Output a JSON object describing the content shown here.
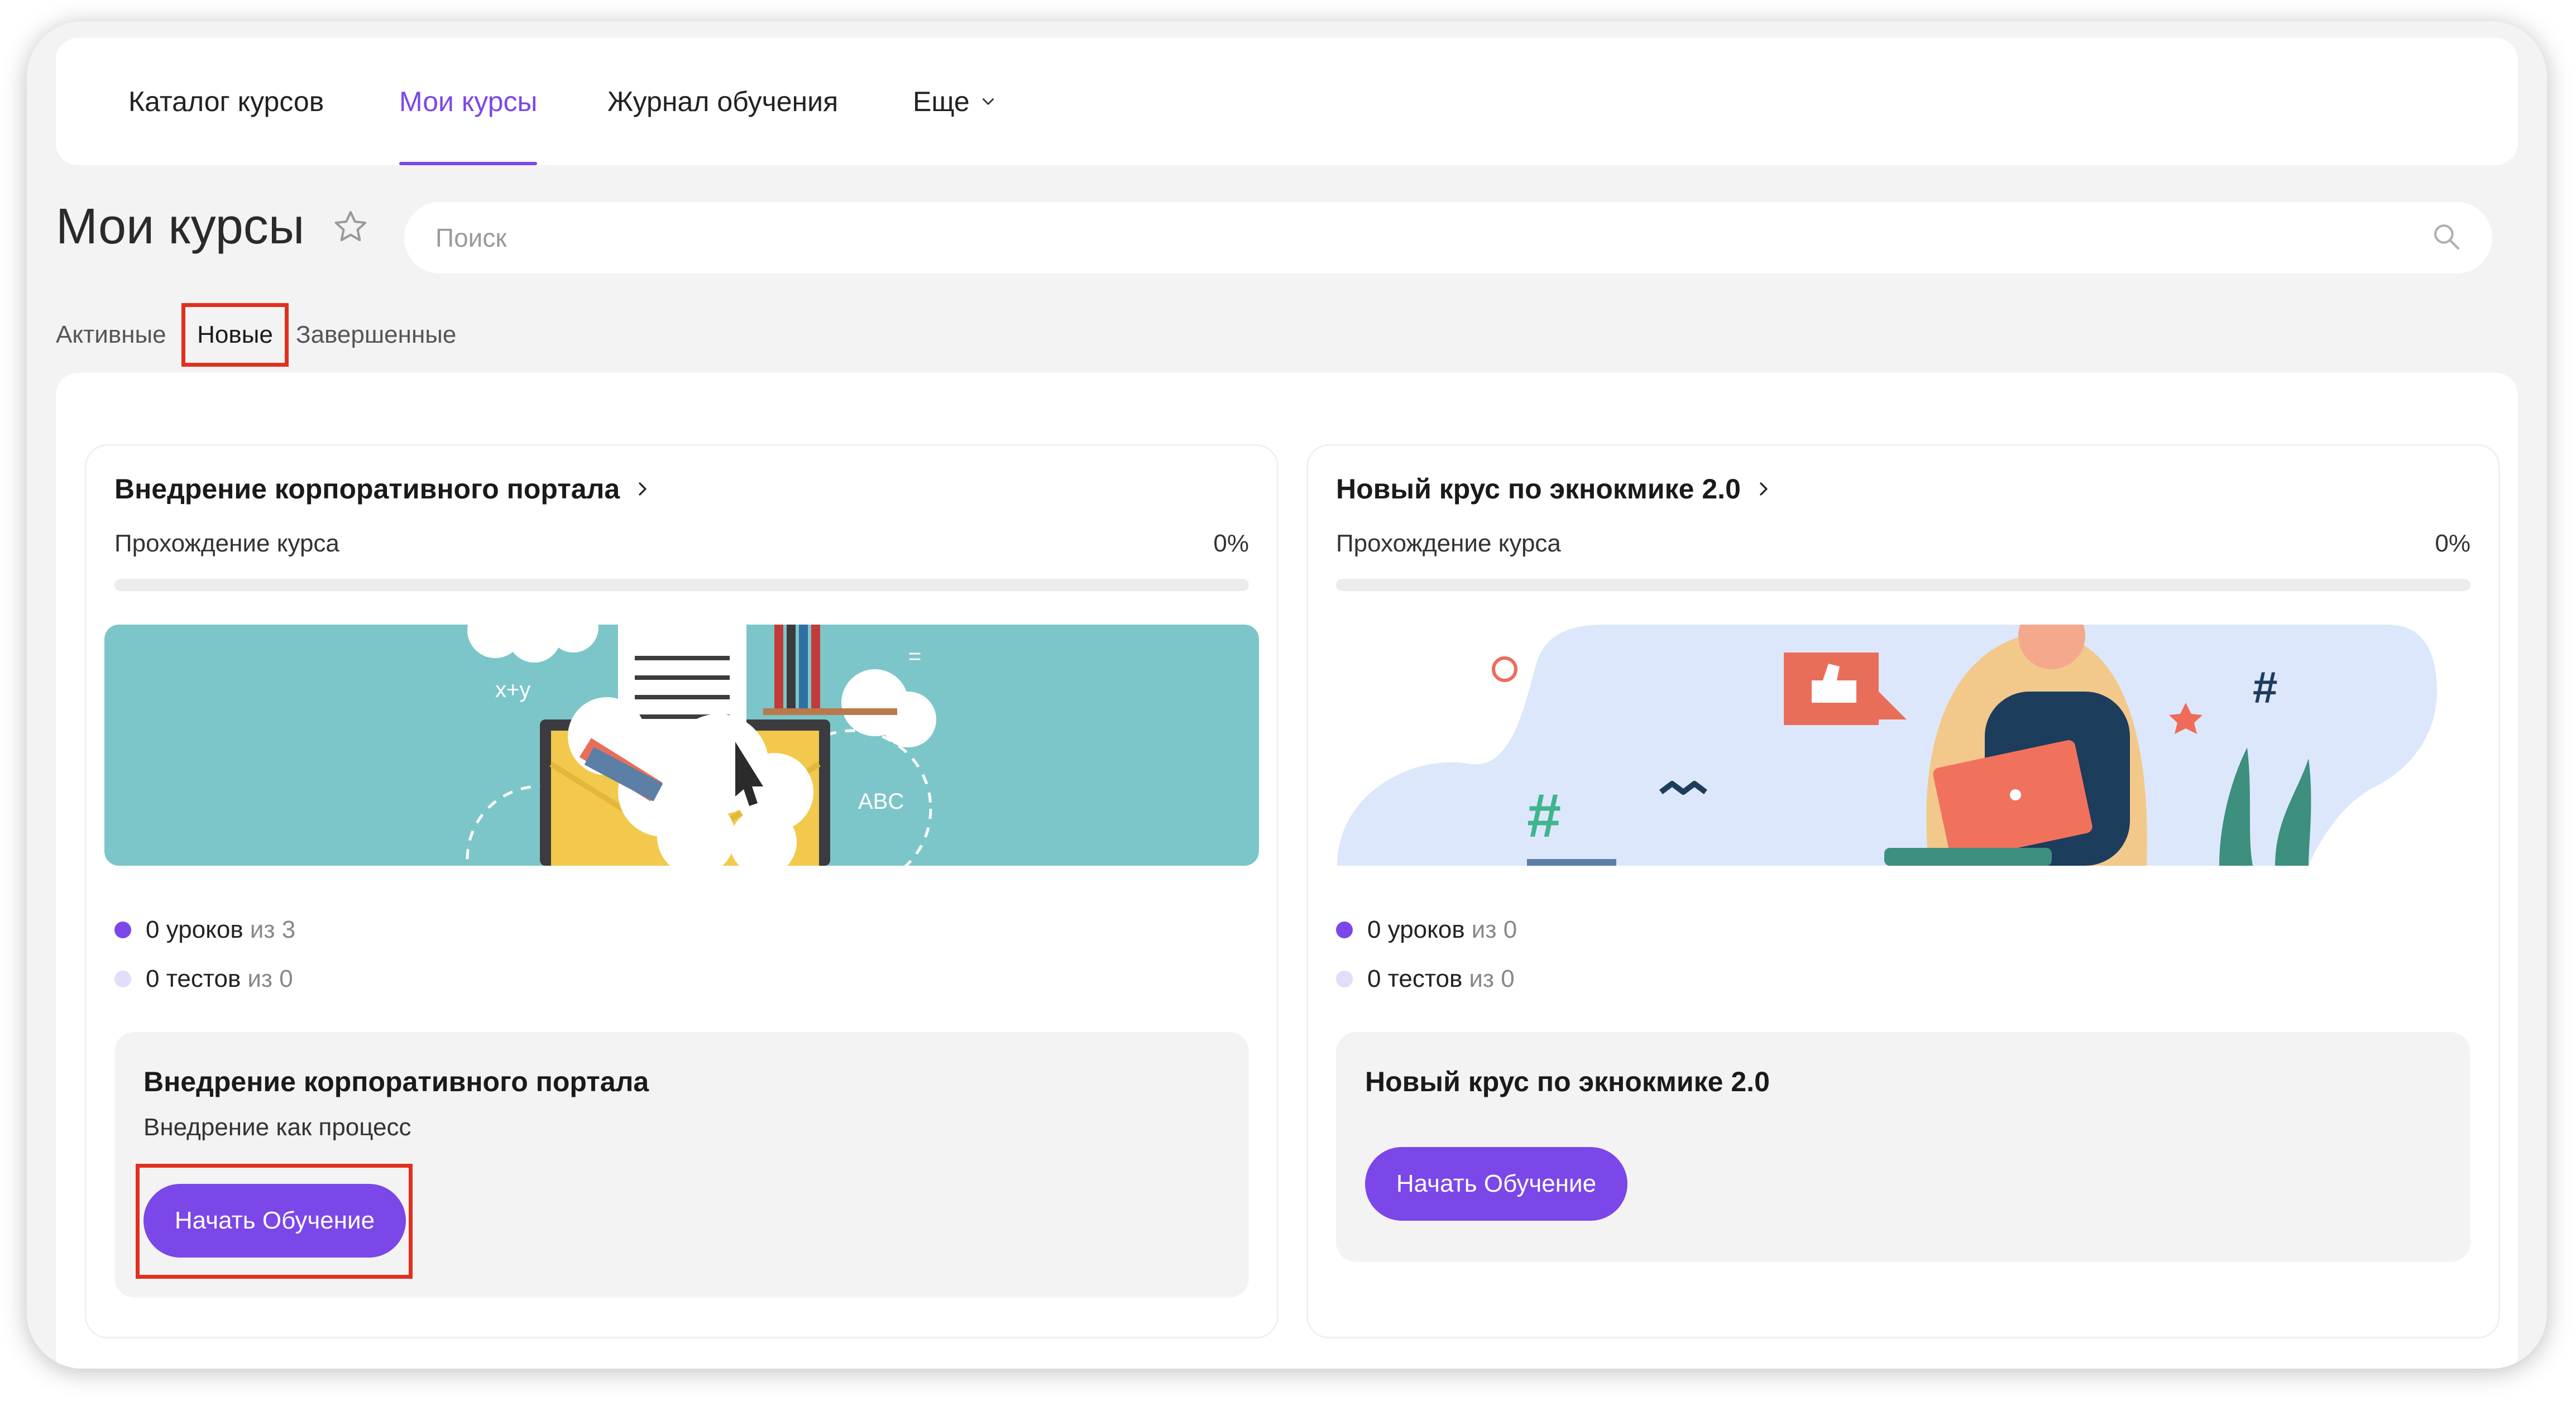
{
  "nav": {
    "items": [
      {
        "label": "Каталог курсов"
      },
      {
        "label": "Мои курсы"
      },
      {
        "label": "Журнал обучения"
      },
      {
        "label": "Еще"
      }
    ]
  },
  "header": {
    "title": "Мои курсы",
    "search_placeholder": "Поиск"
  },
  "filters": [
    "Активные",
    "Новые",
    "Завершенные"
  ],
  "cards": [
    {
      "title": "Внедрение корпоративного портала",
      "progress_label": "Прохождение курса",
      "progress_percent": "0%",
      "progress_value": 0,
      "lessons_label": "0 уроков",
      "lessons_total": "из 3",
      "tests_label": "0 тестов",
      "tests_total": "из 0",
      "box_title": "Внедрение корпоративного портала",
      "box_subtitle": "Внедрение как процесс",
      "button_label": "Начать Обучение"
    },
    {
      "title": "Новый крус по экнокмике 2.0",
      "progress_label": "Прохождение курса",
      "progress_percent": "0%",
      "progress_value": 0,
      "lessons_label": "0 уроков",
      "lessons_total": "из 0",
      "tests_label": "0 тестов",
      "tests_total": "из 0",
      "box_title": "Новый крус по экнокмике 2.0",
      "button_label": "Начать Обучение"
    }
  ],
  "colors": {
    "accent": "#7b47e8",
    "highlight": "#e0301e",
    "lessons_dot": "#7b47e8",
    "tests_dot": "#e3dcfb",
    "banner1_bg": "#7cc6c9",
    "banner2_bg": "#dde7fb"
  }
}
